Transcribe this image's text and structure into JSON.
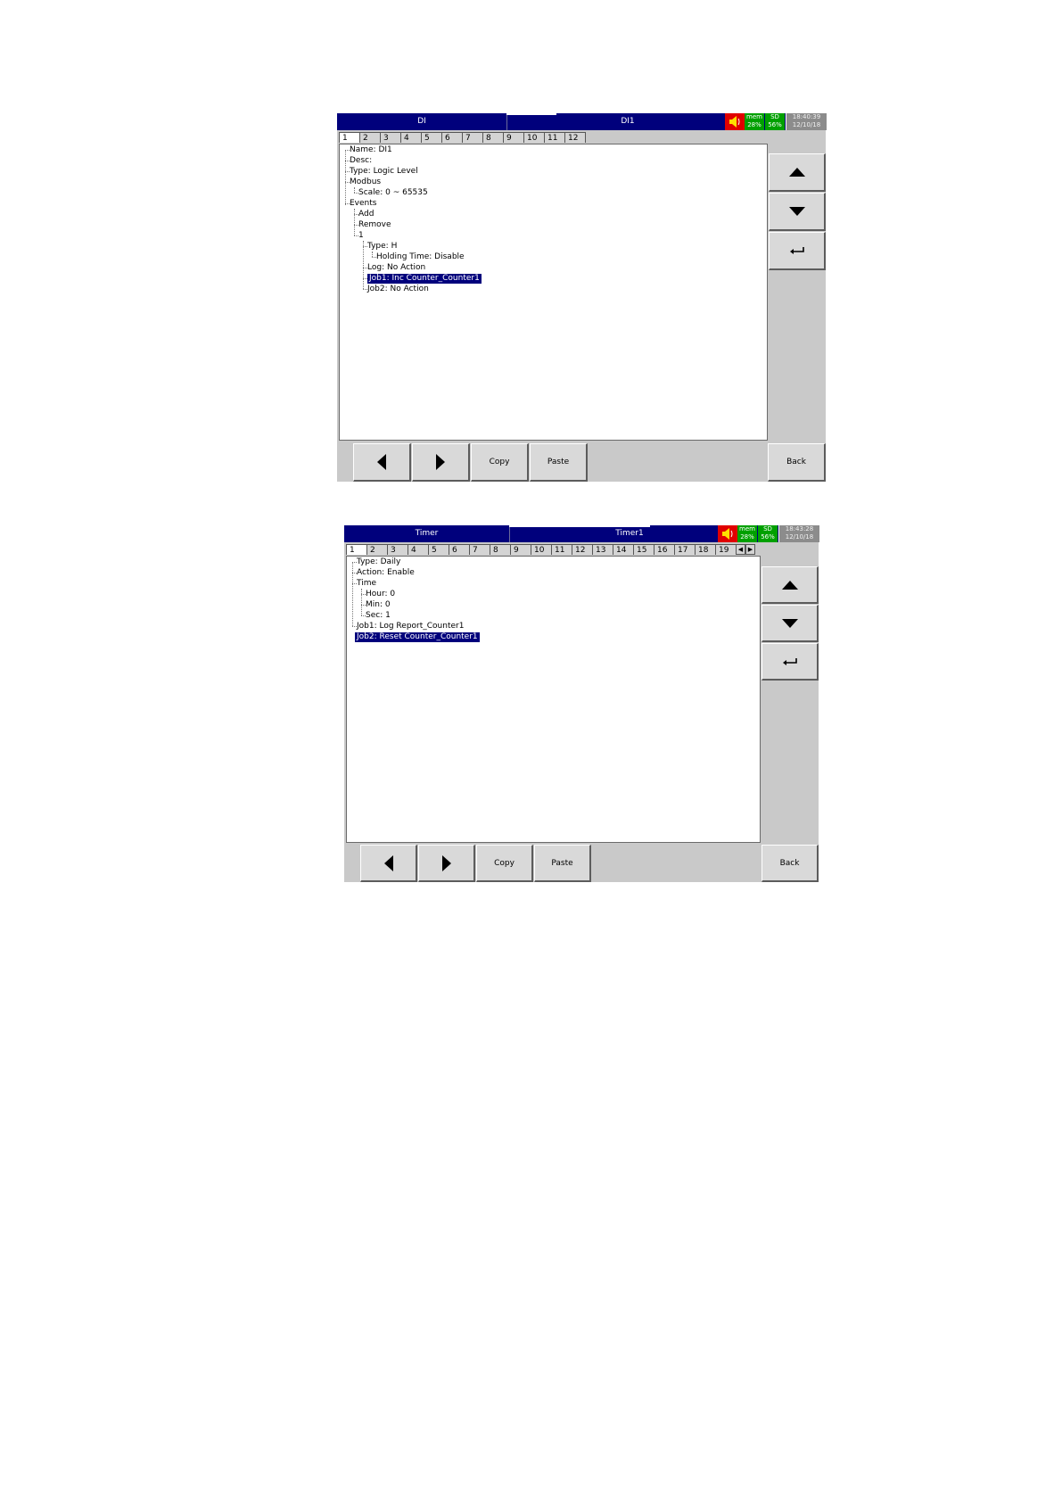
{
  "screen1": {
    "title_left": "DI",
    "title_right": "DI1",
    "mem_label": "mem",
    "mem_value": "28%",
    "sd_label": "SD",
    "sd_value": "56%",
    "clock_time": "18:40:39",
    "clock_date": "12/10/18",
    "tabs": [
      "1",
      "2",
      "3",
      "4",
      "5",
      "6",
      "7",
      "8",
      "9",
      "10",
      "11",
      "12"
    ],
    "tree": {
      "name": "Name: DI1",
      "desc": "Desc:",
      "type": "Type: Logic Level",
      "modbus": "Modbus",
      "scale": "Scale: 0 ~ 65535",
      "events": "Events",
      "add": "Add",
      "remove": "Remove",
      "event1": "1",
      "event_type": "Type: H",
      "holding_time": "Holding Time: Disable",
      "log": "Log: No Action",
      "job1": "Job1: Inc Counter_Counter1",
      "job2": "Job2: No Action"
    },
    "buttons": {
      "copy": "Copy",
      "paste": "Paste",
      "back": "Back"
    }
  },
  "screen2": {
    "title_left": "Timer",
    "title_right": "Timer1",
    "mem_label": "mem",
    "mem_value": "28%",
    "sd_label": "SD",
    "sd_value": "56%",
    "clock_time": "18:43:28",
    "clock_date": "12/10/18",
    "tabs": [
      "1",
      "2",
      "3",
      "4",
      "5",
      "6",
      "7",
      "8",
      "9",
      "10",
      "11",
      "12",
      "13",
      "14",
      "15",
      "16",
      "17",
      "18",
      "19"
    ],
    "tree": {
      "type": "Type: Daily",
      "action": "Action: Enable",
      "time": "Time",
      "hour": "Hour: 0",
      "min": "Min: 0",
      "sec": "Sec: 1",
      "job1": "Job1: Log Report_Counter1",
      "job2": "Job2: Reset Counter_Counter1"
    },
    "buttons": {
      "copy": "Copy",
      "paste": "Paste",
      "back": "Back"
    }
  }
}
